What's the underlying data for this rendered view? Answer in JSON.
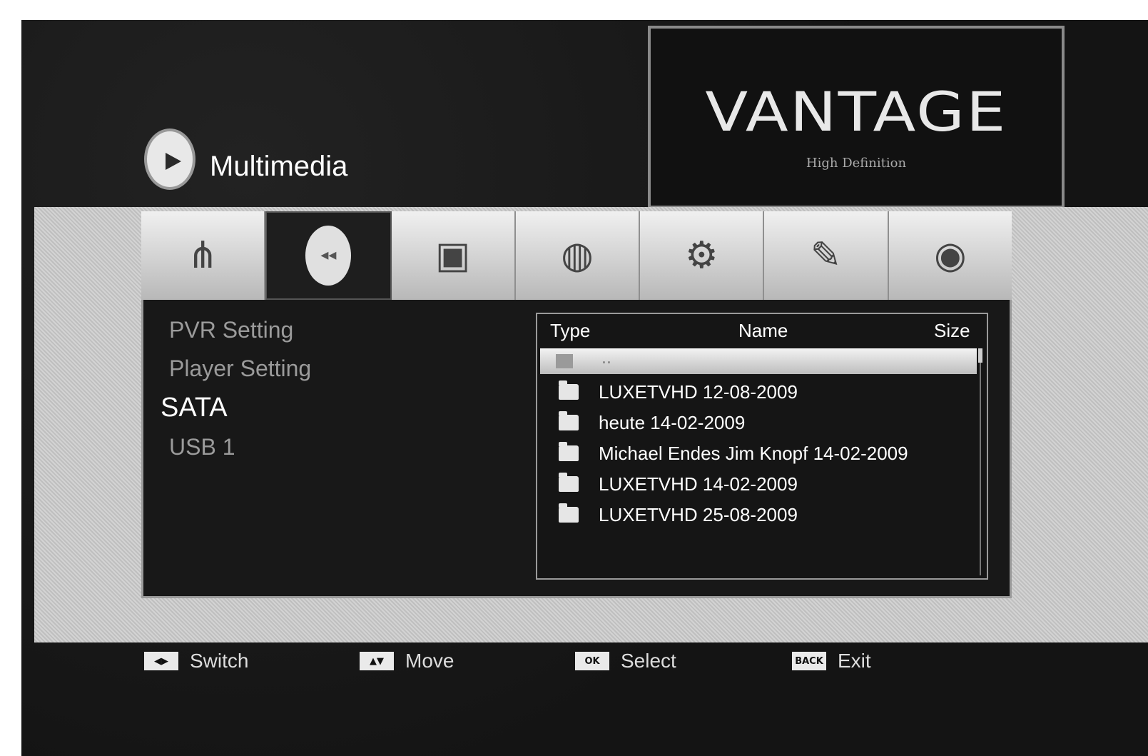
{
  "header": {
    "title": "Multimedia"
  },
  "logo": {
    "brand": "VANTAGE",
    "tagline": "High Definition"
  },
  "tabs": [
    {
      "icon": "antenna-icon",
      "glyph": "⋔"
    },
    {
      "icon": "media-icon",
      "glyph": "◂◂"
    },
    {
      "icon": "printer-icon",
      "glyph": "▣"
    },
    {
      "icon": "globe-icon",
      "glyph": "◍"
    },
    {
      "icon": "gears-icon",
      "glyph": "⚙"
    },
    {
      "icon": "tools-icon",
      "glyph": "✎"
    },
    {
      "icon": "camera-icon",
      "glyph": "◉"
    }
  ],
  "active_tab_index": 1,
  "menu": {
    "items": [
      "PVR Setting",
      "Player Setting",
      "SATA",
      "USB 1"
    ],
    "active_index": 2
  },
  "file_list": {
    "columns": [
      "Type",
      "Name",
      "Size"
    ],
    "selected_row": "..",
    "rows": [
      "LUXETVHD 12-08-2009",
      "heute 14-02-2009",
      "Michael Endes Jim Knopf 14-02-2009",
      "LUXETVHD 14-02-2009",
      "LUXETVHD 25-08-2009"
    ]
  },
  "footer": [
    {
      "key": "◀▶",
      "label": "Switch"
    },
    {
      "key": "▲▼",
      "label": "Move"
    },
    {
      "key": "OK",
      "label": "Select"
    },
    {
      "key": "BACK",
      "label": "Exit"
    }
  ]
}
